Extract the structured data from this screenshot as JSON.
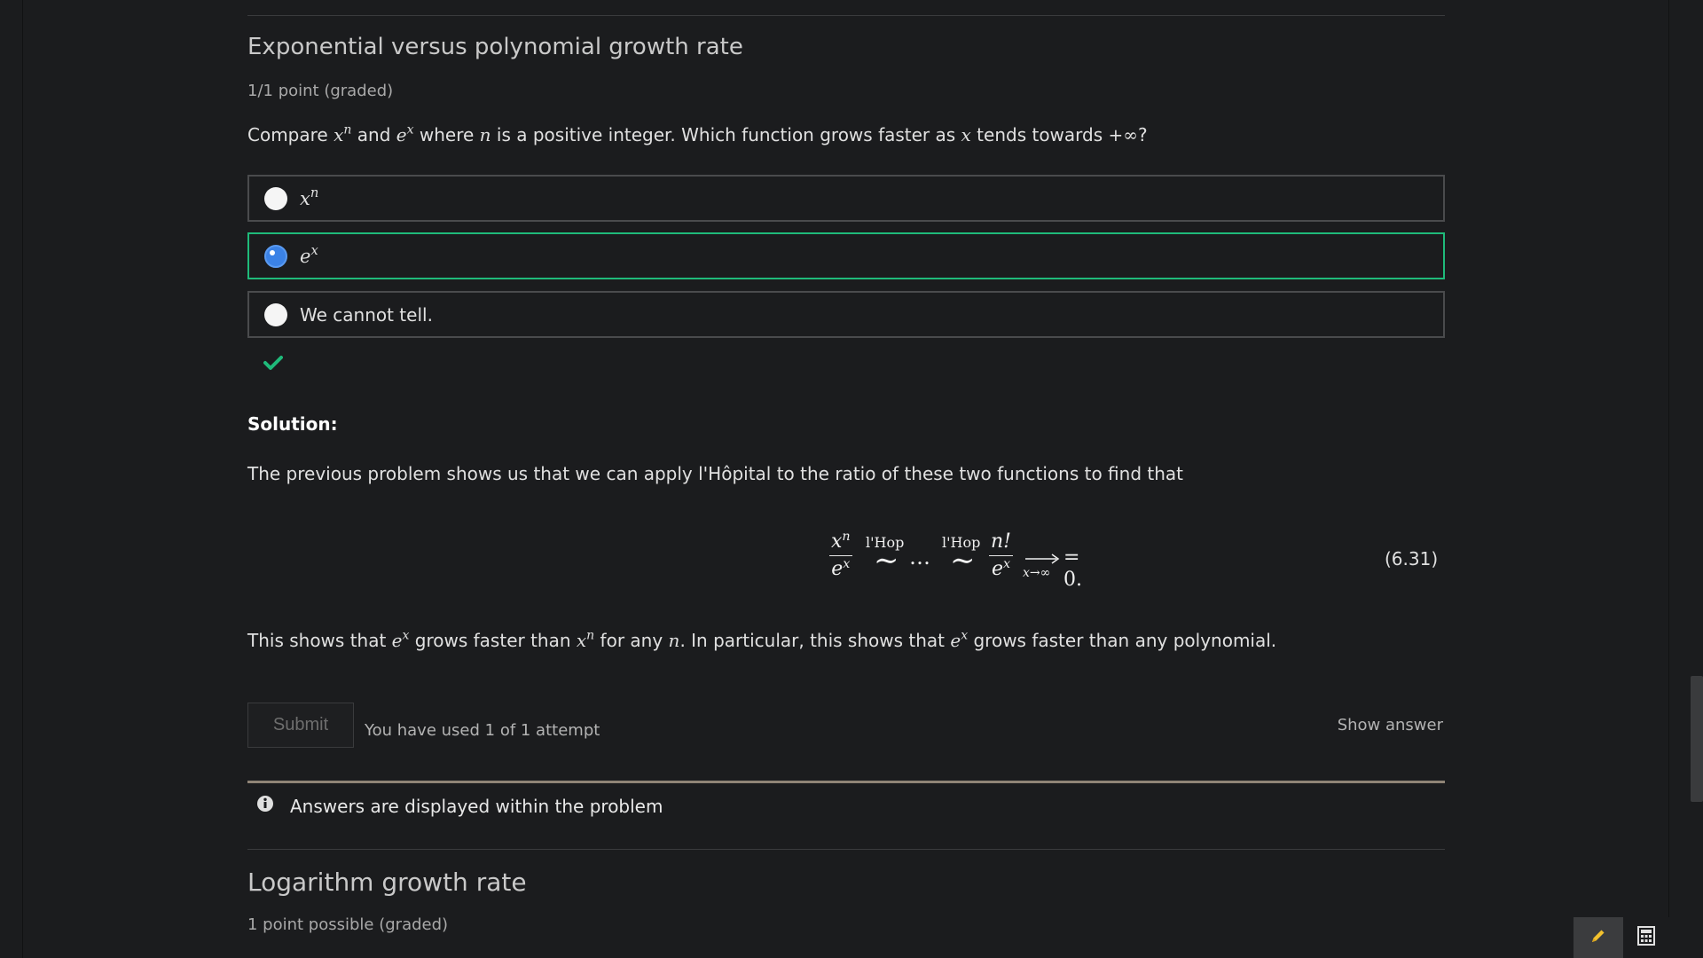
{
  "problem": {
    "title": "Exponential versus polynomial growth rate",
    "points": "1/1 point (graded)",
    "question": {
      "prefix": "Compare ",
      "f1": "x",
      "f1_exp": "n",
      "and": " and ",
      "f2": "e",
      "f2_exp": "x",
      "where": " where ",
      "n": "n",
      "middle": " is a positive integer. Which function grows faster as ",
      "x": "x",
      "tends": " tends towards ",
      "infinity": "+∞",
      "suffix": "?"
    },
    "options": [
      {
        "base": "x",
        "exp": "n",
        "selected": false
      },
      {
        "base": "e",
        "exp": "x",
        "selected": true
      },
      {
        "label": "We cannot tell.",
        "selected": false
      }
    ],
    "result_icon": "check-icon",
    "result_color": "#1fba7a"
  },
  "solution": {
    "heading": "Solution:",
    "intro": "The previous problem shows us that we can apply l'Hôpital to the ratio of these two functions to find that",
    "equation": {
      "frac1_num_base": "x",
      "frac1_num_exp": "n",
      "frac1_den_base": "e",
      "frac1_den_exp": "x",
      "hop_label": "l'Hop",
      "tilde": "∼",
      "dots": "…",
      "frac2_num": "n!",
      "frac2_den_base": "e",
      "frac2_den_exp": "x",
      "limit_sub": "x→∞",
      "result": "= 0."
    },
    "equation_number": "(6.31)",
    "conclusion": {
      "t1": "This shows that ",
      "ex_base": "e",
      "ex_exp": "x",
      "t2": " grows faster than ",
      "xn_base": "x",
      "xn_exp": "n",
      "t3": " for any ",
      "n": "n",
      "t4": ". In particular, this shows that ",
      "ex2_base": "e",
      "ex2_exp": "x",
      "t5": " grows faster than any polynomial."
    }
  },
  "actions": {
    "submit_label": "Submit",
    "attempts_text": "You have used 1 of 1 attempt",
    "show_answer_label": "Show answer"
  },
  "notice": {
    "icon": "info-icon",
    "text": "Answers are displayed within the problem"
  },
  "next_problem": {
    "title": "Logarithm growth rate",
    "points": "1 point possible (graded)"
  },
  "tools": {
    "pencil_icon": "pencil-icon",
    "pencil_color": "#f2c12e",
    "calculator_icon": "calculator-icon"
  }
}
